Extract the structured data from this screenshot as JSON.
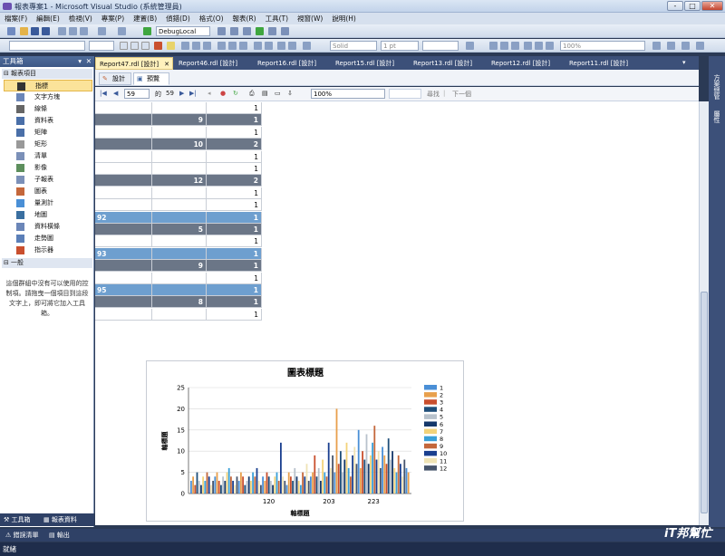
{
  "window": {
    "title": "報表專案1 - Microsoft Visual Studio (系統管理員)",
    "buttons": [
      "-",
      "□",
      "✕"
    ]
  },
  "menu": [
    "檔案(F)",
    "編輯(E)",
    "檢視(V)",
    "專案(P)",
    "建置(B)",
    "偵錯(D)",
    "格式(O)",
    "報表(R)",
    "工具(T)",
    "視窗(W)",
    "說明(H)"
  ],
  "toolbar1": {
    "config": "DebugLocal"
  },
  "toolbar2": {
    "line_style": "Solid",
    "line_width": "1 pt",
    "zoom": "100%"
  },
  "toolbox": {
    "title": "工具箱",
    "section_report": "報表項目",
    "items": [
      {
        "label": "指標",
        "icon": "pointer-icon",
        "selected": true
      },
      {
        "label": "文字方塊",
        "icon": "textbox-icon"
      },
      {
        "label": "線條",
        "icon": "line-icon"
      },
      {
        "label": "資料表",
        "icon": "table-icon"
      },
      {
        "label": "矩陣",
        "icon": "matrix-icon"
      },
      {
        "label": "矩形",
        "icon": "rectangle-icon"
      },
      {
        "label": "清單",
        "icon": "list-icon"
      },
      {
        "label": "影像",
        "icon": "image-icon"
      },
      {
        "label": "子報表",
        "icon": "subreport-icon"
      },
      {
        "label": "圖表",
        "icon": "chart-icon"
      },
      {
        "label": "量測計",
        "icon": "gauge-icon"
      },
      {
        "label": "地圖",
        "icon": "map-icon"
      },
      {
        "label": "資料橫條",
        "icon": "databar-icon"
      },
      {
        "label": "走勢圖",
        "icon": "sparkline-icon"
      },
      {
        "label": "指示器",
        "icon": "indicator-icon"
      }
    ],
    "section_general": "一般",
    "note": "這個群組中沒有可以使用的控制項。請拖曳一個項目到這段文字上，即可將它加入工具箱。",
    "bottom_tabs": [
      "工具箱",
      "報表資料"
    ]
  },
  "doc_tabs": [
    "Report47.rdl [設計]",
    "Report46.rdl [設計]",
    "Report16.rdl [設計]",
    "Report15.rdl [設計]",
    "Report13.rdl [設計]",
    "Report12.rdl [設計]",
    "Report11.rdl [設計]"
  ],
  "view_tabs": [
    "設計",
    "預覽"
  ],
  "nav": {
    "page": "59",
    "of": "的",
    "total": "59",
    "zoom": "100%",
    "find": "尋找",
    "next": "下一個"
  },
  "table_rows": [
    {
      "style": "light",
      "c1": "",
      "c2": "",
      "c3": "1"
    },
    {
      "style": "dark",
      "c1": "",
      "c2": "9",
      "c3": "1"
    },
    {
      "style": "light",
      "c1": "",
      "c2": "",
      "c3": "1"
    },
    {
      "style": "dark",
      "c1": "",
      "c2": "10",
      "c3": "2"
    },
    {
      "style": "light",
      "c1": "",
      "c2": "",
      "c3": "1"
    },
    {
      "style": "light",
      "c1": "",
      "c2": "",
      "c3": "1"
    },
    {
      "style": "dark",
      "c1": "",
      "c2": "12",
      "c3": "2"
    },
    {
      "style": "light",
      "c1": "",
      "c2": "",
      "c3": "1"
    },
    {
      "style": "light",
      "c1": "",
      "c2": "",
      "c3": "1"
    },
    {
      "style": "blue",
      "c1": "92",
      "c2": "",
      "c3": "1"
    },
    {
      "style": "dark",
      "c1": "",
      "c2": "5",
      "c3": "1"
    },
    {
      "style": "light",
      "c1": "",
      "c2": "",
      "c3": "1"
    },
    {
      "style": "blue",
      "c1": "93",
      "c2": "",
      "c3": "1"
    },
    {
      "style": "dark",
      "c1": "",
      "c2": "9",
      "c3": "1"
    },
    {
      "style": "light",
      "c1": "",
      "c2": "",
      "c3": "1"
    },
    {
      "style": "blue",
      "c1": "95",
      "c2": "",
      "c3": "1"
    },
    {
      "style": "dark",
      "c1": "",
      "c2": "8",
      "c3": "1"
    },
    {
      "style": "light",
      "c1": "",
      "c2": "",
      "c3": "1"
    }
  ],
  "chart_data": {
    "type": "bar",
    "title": "圖表標題",
    "xlabel": "軸標題",
    "ylabel": "軸標題",
    "ylim": [
      0,
      25
    ],
    "yticks": [
      0,
      5,
      10,
      15,
      20,
      25
    ],
    "xticks": [
      "120",
      "203",
      "223"
    ],
    "legend_position": "right",
    "legend": [
      "1",
      "2",
      "3",
      "4",
      "5",
      "6",
      "7",
      "8",
      "9",
      "10",
      "11",
      "12"
    ],
    "colors": [
      "#4a8fd6",
      "#e8a04c",
      "#c94f2e",
      "#1f4e79",
      "#b8c2cc",
      "#15386b",
      "#f3d37a",
      "#3aa0d8",
      "#c4673b",
      "#1a3f8f",
      "#efe3b5",
      "#46546b"
    ],
    "values": [
      3,
      4,
      2,
      5,
      3,
      2,
      4,
      3,
      5,
      4,
      2,
      3,
      4,
      5,
      3,
      2,
      4,
      3,
      5,
      6,
      4,
      3,
      2,
      4,
      3,
      5,
      4,
      2,
      3,
      4,
      3,
      5,
      4,
      6,
      3,
      2,
      4,
      3,
      5,
      4,
      3,
      2,
      4,
      5,
      3,
      12,
      4,
      3,
      2,
      5,
      4,
      3,
      6,
      4,
      3,
      2,
      5,
      4,
      7,
      3,
      4,
      5,
      9,
      4,
      6,
      3,
      8,
      5,
      4,
      12,
      6,
      9,
      5,
      20,
      7,
      10,
      5,
      8,
      12,
      6,
      4,
      9,
      11,
      7,
      15,
      6,
      10,
      8,
      14,
      7,
      9,
      12,
      16,
      8,
      10,
      6,
      11,
      9,
      7,
      13,
      8,
      10,
      6,
      5,
      9,
      7,
      4,
      8,
      6,
      5
    ]
  },
  "status": {
    "text": "就緒",
    "bottom_tabs": [
      "錯誤清單",
      "輸出"
    ]
  },
  "watermark": "iT邦幫忙"
}
